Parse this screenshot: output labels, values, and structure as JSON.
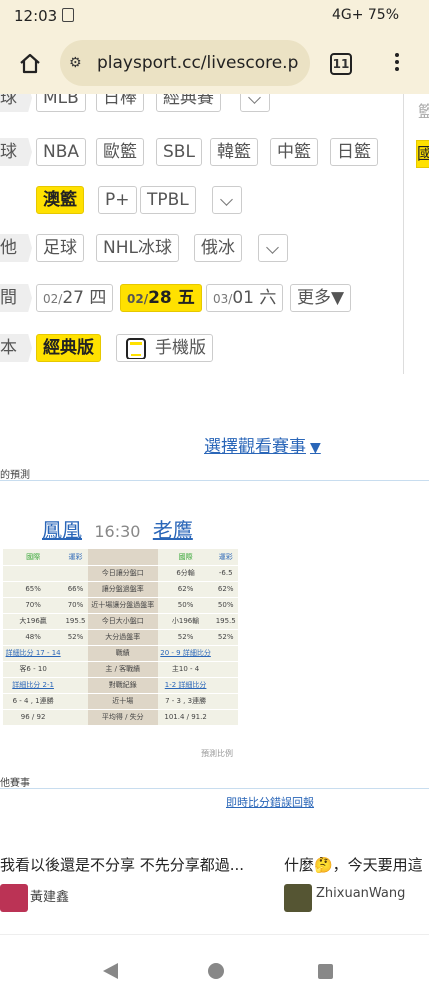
{
  "status": {
    "time": "12:03",
    "indicators": "4G+ 75%"
  },
  "browser": {
    "url": "playsport.cc/livescore.p",
    "tab_count": "11",
    "site_icon": "tune-icon"
  },
  "nav_rows": [
    {
      "label": "球",
      "chips": [
        "MLB",
        "日棒",
        "經典賽"
      ]
    },
    {
      "label": "球",
      "chips": [
        "NBA",
        "歐籃",
        "SBL",
        "韓籃",
        "中籃",
        "日籃"
      ]
    },
    {
      "label": "",
      "chips": [
        "澳籃",
        "P+",
        "TPBL"
      ]
    },
    {
      "label": "他",
      "chips": [
        "足球",
        "NHL冰球",
        "俄冰"
      ]
    },
    {
      "label": "間",
      "dates": [
        {
          "md": "02/",
          "day": "27",
          "wd": "四"
        },
        {
          "md": "02/",
          "day": "28",
          "wd": "五"
        },
        {
          "md": "03/",
          "day": "01",
          "wd": "六"
        }
      ],
      "more": "更多▼"
    },
    {
      "label": "本",
      "chips": [
        "經典版",
        "手機版"
      ]
    }
  ],
  "right_col": {
    "a": "籃",
    "b": "國"
  },
  "select_link": "選擇觀看賽事",
  "section_prediction": "的預測",
  "match": {
    "home": "鳳凰",
    "time": "16:30",
    "away": "老鷹"
  },
  "prediction_table": {
    "headers": [
      "國際",
      "運彩",
      "",
      "國際",
      "運彩"
    ],
    "rows": [
      [
        "",
        "",
        "今日讓分盤口",
        "6分輸",
        "-6.5"
      ],
      [
        "65%",
        "66%",
        "讓分盤過盤率",
        "62%",
        "62%"
      ],
      [
        "70%",
        "70%",
        "近十場讓分盤過盤率",
        "50%",
        "50%"
      ],
      [
        "大196贏",
        "195.5",
        "今日大小盤口",
        "小196輸",
        "195.5"
      ],
      [
        "48%",
        "52%",
        "大分過盤率",
        "52%",
        "52%"
      ],
      [
        "詳細比分 17 - 14",
        "",
        "戰績",
        "20 - 9 詳細比分",
        ""
      ],
      [
        "客6 - 10",
        "",
        "主 / 客戰績",
        "主10 - 4",
        ""
      ],
      [
        "詳細比分 2-1",
        "",
        "對戰紀錄",
        "1-2 詳細比分",
        ""
      ],
      [
        "6 - 4 , 1連勝",
        "",
        "近十場",
        "7 - 3 , 3連勝",
        ""
      ],
      [
        "96 / 92",
        "",
        "平均得 / 失分",
        "101.4 / 91.2",
        ""
      ]
    ],
    "note": "預測比例"
  },
  "section_other": "他賽事",
  "feedback_link": "即時比分錯誤回報",
  "news": [
    {
      "title": "我看以後還是不分享 不先分享都過...",
      "author": "黃建鑫"
    },
    {
      "title": "什麼🤔，今天要用這",
      "author": "ZhixuanWang"
    }
  ]
}
